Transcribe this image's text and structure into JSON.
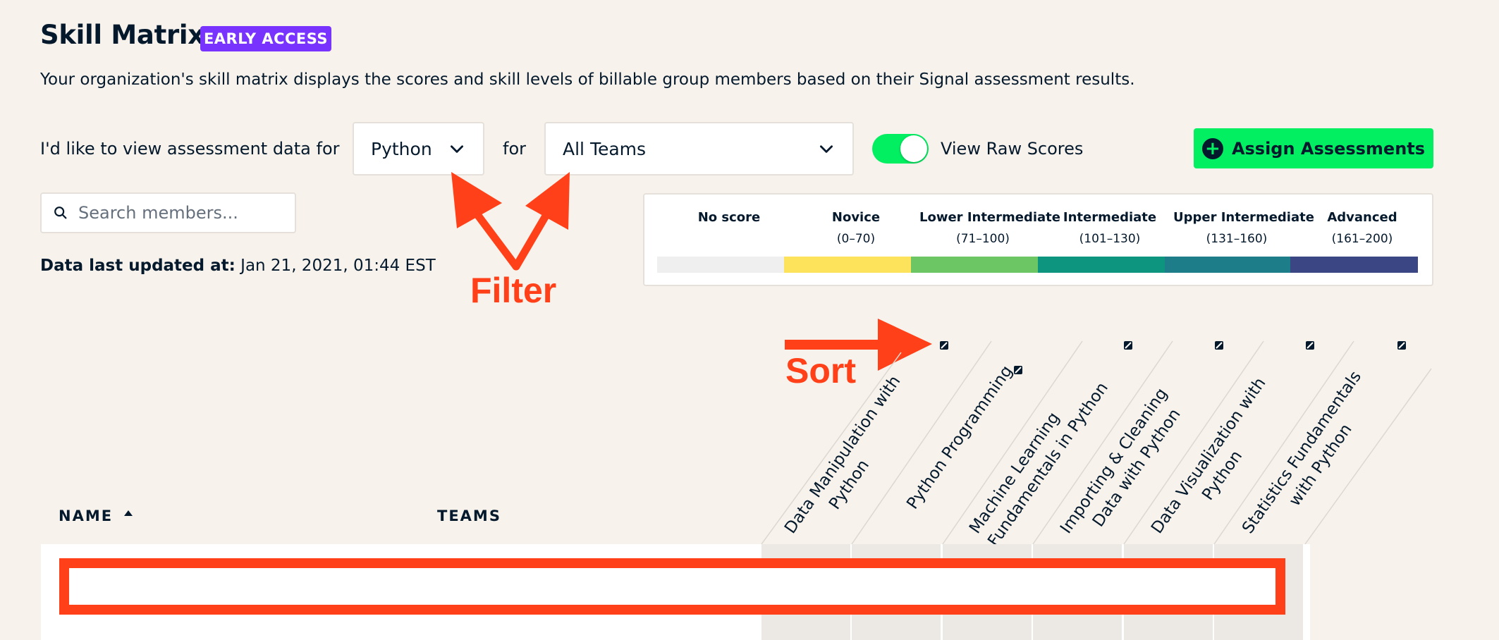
{
  "header": {
    "title": "Skill Matrix",
    "badge": "EARLY ACCESS",
    "description": "Your organization's skill matrix displays the scores and skill levels of billable group members based on their Signal assessment results."
  },
  "filters": {
    "label": "I'd like to view assessment data for",
    "technology": "Python",
    "for_label": "for",
    "team": "All Teams",
    "toggle_label": "View Raw Scores",
    "toggle_on": true
  },
  "assign_button": {
    "label": "Assign Assessments"
  },
  "search": {
    "placeholder": "Search members..."
  },
  "updated": {
    "label": "Data last updated at:",
    "value": "Jan 21, 2021, 01:44 EST"
  },
  "legend": {
    "levels": [
      {
        "name": "No score",
        "range": "",
        "color": "#efefef"
      },
      {
        "name": "Novice",
        "range": "(0–70)",
        "color": "#fde25b"
      },
      {
        "name": "Lower Intermediate",
        "range": "(71–100)",
        "color": "#6cc664"
      },
      {
        "name": "Intermediate",
        "range": "(101–130)",
        "color": "#0e9580"
      },
      {
        "name": "Upper Intermediate",
        "range": "(131–160)",
        "color": "#1d7e8a"
      },
      {
        "name": "Advanced",
        "range": "(161–200)",
        "color": "#3b4684"
      }
    ]
  },
  "annotations": {
    "filter": "Filter",
    "sort": "Sort",
    "color": "#ff4018"
  },
  "table": {
    "name_header": "NAME",
    "teams_header": "TEAMS",
    "columns": [
      {
        "line1": "Data Manipulation with",
        "line2": "Python"
      },
      {
        "line1": "Python Programming",
        "line2": ""
      },
      {
        "line1": "Machine Learning",
        "line2": "Fundamentals in Python"
      },
      {
        "line1": "Importing & Cleaning",
        "line2": "Data with Python"
      },
      {
        "line1": "Data Visualization with",
        "line2": "Python"
      },
      {
        "line1": "Statistics Fundamentals",
        "line2": "with Python"
      }
    ]
  }
}
